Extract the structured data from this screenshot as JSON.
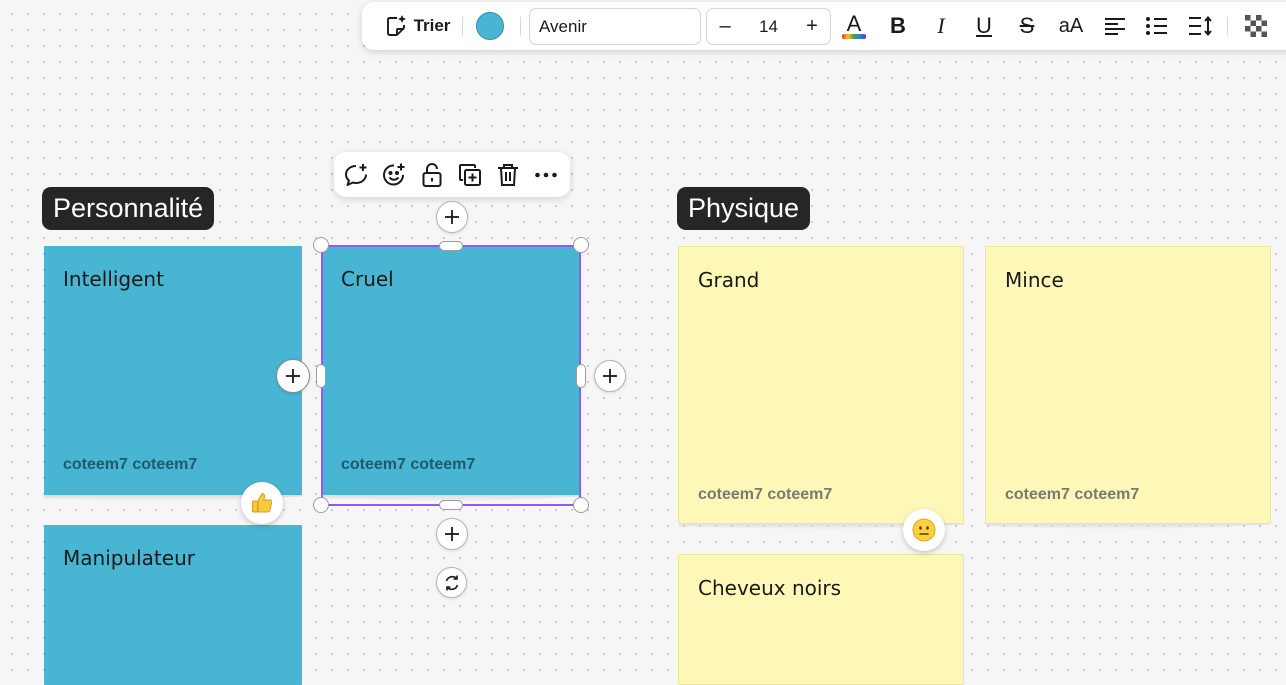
{
  "toolbar": {
    "sort_label": "Trier",
    "note_color": "#48b5d2",
    "font": "Avenir",
    "font_size": "14",
    "minus": "–",
    "plus": "+",
    "text_color_glyph": "A",
    "bold_glyph": "B",
    "italic_glyph": "I",
    "underline_glyph": "U",
    "strike_glyph": "S",
    "case_glyph": "aA",
    "icons": [
      "sort-sparkle-icon",
      "text-color-icon",
      "bold-icon",
      "italic-icon",
      "underline-icon",
      "strikethrough-icon",
      "text-case-icon",
      "align-left-icon",
      "bullet-list-icon",
      "line-spacing-icon",
      "opacity-icon"
    ]
  },
  "floating_toolbar": {
    "icons": [
      "add-comment-icon",
      "add-reaction-icon",
      "lock-icon",
      "duplicate-icon",
      "delete-icon",
      "more-icon"
    ]
  },
  "frames": [
    {
      "label": "Personnalité",
      "color": "#48b5d2",
      "notes": [
        {
          "text": "Intelligent",
          "author": "coteem7 coteem7"
        },
        {
          "text": "Cruel",
          "author": "coteem7 coteem7"
        },
        {
          "text": "Manipulateur",
          "author": ""
        }
      ]
    },
    {
      "label": "Physique",
      "color": "#fdf8b8",
      "notes": [
        {
          "text": "Grand",
          "author": "coteem7 coteem7"
        },
        {
          "text": "Mince",
          "author": "coteem7 coteem7"
        },
        {
          "text": "Cheveux noirs",
          "author": ""
        }
      ]
    }
  ],
  "reactions": [
    "thumbs-up-emoji",
    "neutral-face-emoji"
  ]
}
